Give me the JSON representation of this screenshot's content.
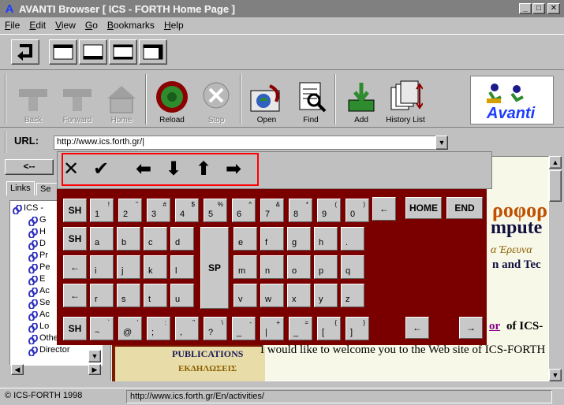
{
  "window": {
    "title": "AVANTI Browser [  ICS - FORTH Home Page ]"
  },
  "menu": [
    "File",
    "Edit",
    "View",
    "Go",
    "Bookmarks",
    "Help"
  ],
  "menu_accel": [
    "F",
    "E",
    "V",
    "G",
    "B",
    "H"
  ],
  "toolbar": {
    "back": "Back",
    "forward": "Forward",
    "home": "Home",
    "reload": "Reload",
    "stop": "Stop",
    "open": "Open",
    "find": "Find",
    "add": "Add",
    "history": "History List"
  },
  "logo_text": "Avanti",
  "url": {
    "label": "URL:",
    "value": "http://www.ics.forth.gr/|"
  },
  "side": {
    "back_arrow": "<--",
    "tabs": [
      "Links",
      "Se"
    ],
    "tree_items": [
      "ICS -",
      "G",
      "H",
      "D",
      "Pr",
      "Pe",
      "E",
      "Ac",
      "Se",
      "Ac",
      "Lo",
      "Other sites",
      "Director"
    ]
  },
  "onscreen_kb": {
    "top_controls": [
      "✕",
      "✔",
      "⬅",
      "⬇",
      "⬆",
      "➡"
    ],
    "row1": [
      {
        "main": "SH",
        "sup": ""
      },
      {
        "main": "1",
        "sup": "!"
      },
      {
        "main": "2",
        "sup": "\""
      },
      {
        "main": "3",
        "sup": "#"
      },
      {
        "main": "4",
        "sup": "$"
      },
      {
        "main": "5",
        "sup": "%"
      },
      {
        "main": "6",
        "sup": "^"
      },
      {
        "main": "7",
        "sup": "&"
      },
      {
        "main": "8",
        "sup": "*"
      },
      {
        "main": "9",
        "sup": "("
      },
      {
        "main": "0",
        "sup": ")"
      }
    ],
    "row2": [
      "SH",
      "a",
      "b",
      "c",
      "d",
      "e",
      "f",
      "g",
      "h",
      "."
    ],
    "row3": [
      "←",
      "i",
      "j",
      "k",
      "l",
      "m",
      "n",
      "o",
      "p",
      "q"
    ],
    "row4": [
      "←",
      "r",
      "s",
      "t",
      "u",
      "v",
      "w",
      "x",
      "y",
      "z"
    ],
    "row5": [
      {
        "main": "SH",
        "sup": ""
      },
      {
        "main": "~",
        "sup": "`"
      },
      {
        "main": "@",
        "sup": "'"
      },
      {
        "main": ";",
        "sup": ":"
      },
      {
        "main": ",",
        "sup": "\""
      },
      {
        "main": "?",
        "sup": "\\"
      },
      {
        "main": "_",
        "sup": "-"
      },
      {
        "main": "|",
        "sup": "+"
      },
      {
        "main": "_",
        "sup": "="
      },
      {
        "main": "[",
        "sup": "{"
      },
      {
        "main": "]",
        "sup": "}"
      }
    ],
    "space": "SP",
    "home": "HOME",
    "end": "END",
    "backspace": "←",
    "left": "←",
    "right": "→"
  },
  "page": {
    "greek_title_partial": "ροφορ",
    "english_partial": "mpute",
    "greek_sub_partial": "α Έρευνα",
    "english_sub_partial": "n and Tec",
    "link_partial": "or",
    "text_after_link": "of ICS-",
    "publications": "PUBLICATIONS",
    "publications_greek": "ΕΚΔΗΛΩΣΕΙΣ",
    "welcome": "I would like to welcome you to the Web site of ICS-FORTH"
  },
  "status": {
    "left": "© ICS-FORTH 1998",
    "right": "http://www.ics.forth.gr/En/activities/"
  },
  "colors": {
    "titlebar": "#808080",
    "keyboard_frame": "#7a0000",
    "page_bg": "#f8f8e8",
    "highlight": "#ff0000"
  }
}
